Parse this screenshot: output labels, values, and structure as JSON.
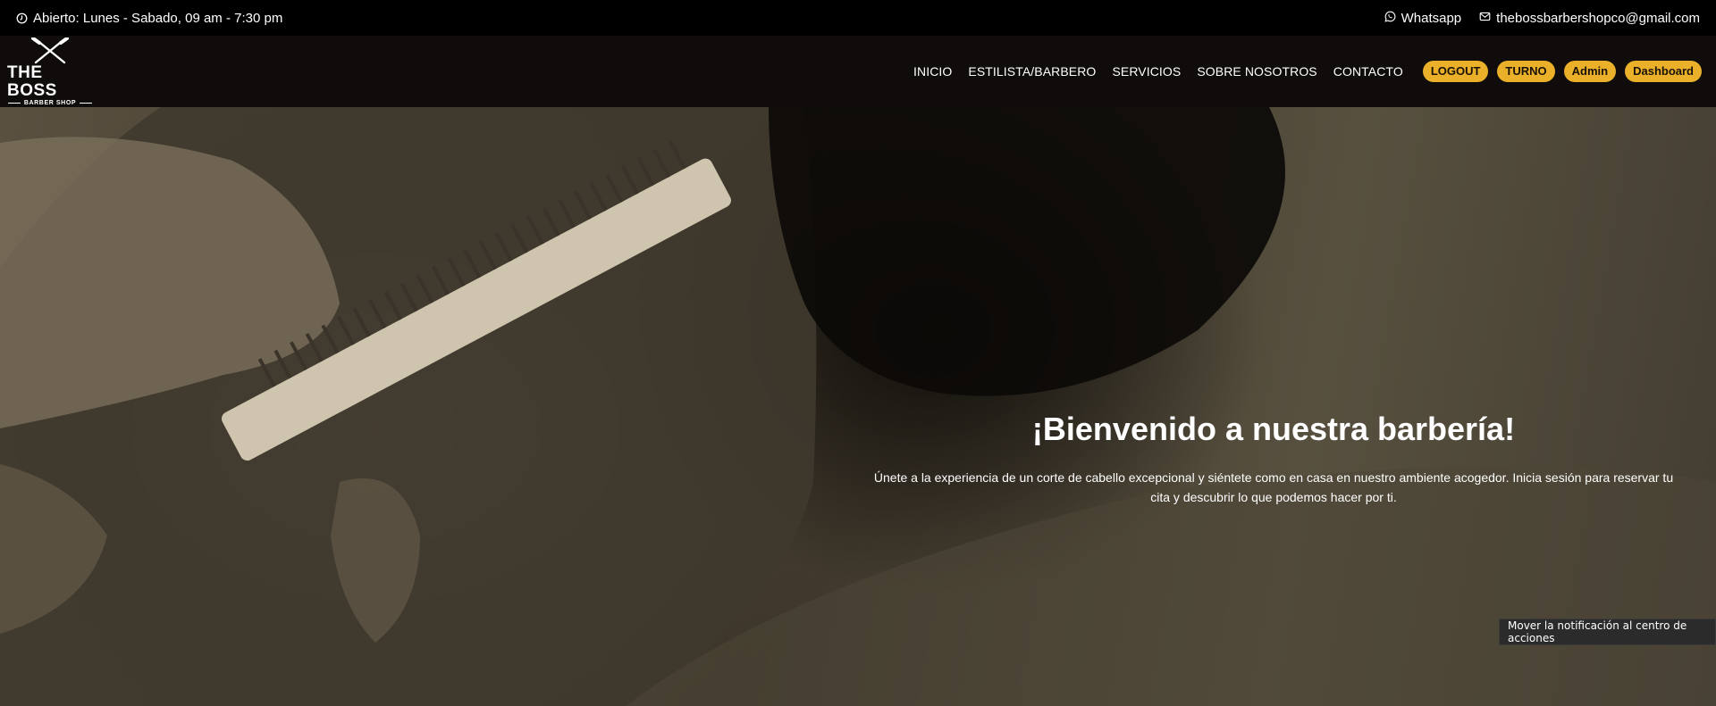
{
  "topbar": {
    "hours": "Abierto: Lunes - Sabado, 09 am - 7:30 pm",
    "whatsapp": "Whatsapp",
    "email": "thebossbarbershopco@gmail.com"
  },
  "logo": {
    "brand": "THE BOSS",
    "sub": "BARBER SHOP"
  },
  "nav": {
    "links": [
      "INICIO",
      "ESTILISTA/BARBERO",
      "SERVICIOS",
      "SOBRE NOSOTROS",
      "CONTACTO"
    ],
    "buttons": [
      "LOGOUT",
      "TURNO",
      "Admin",
      "Dashboard"
    ]
  },
  "hero": {
    "title": "¡Bienvenido a nuestra barbería!",
    "subtitle": "Únete a la experiencia de un corte de cabello excepcional y siéntete como en casa en nuestro ambiente acogedor. Inicia sesión para reservar tu cita y descubrir lo que podemos hacer por ti."
  },
  "toast": {
    "text": "Mover la notificación al centro de acciones"
  },
  "colors": {
    "accent": "#eab02a",
    "navbar_bg": "#100c0b",
    "topbar_bg": "#000000"
  }
}
